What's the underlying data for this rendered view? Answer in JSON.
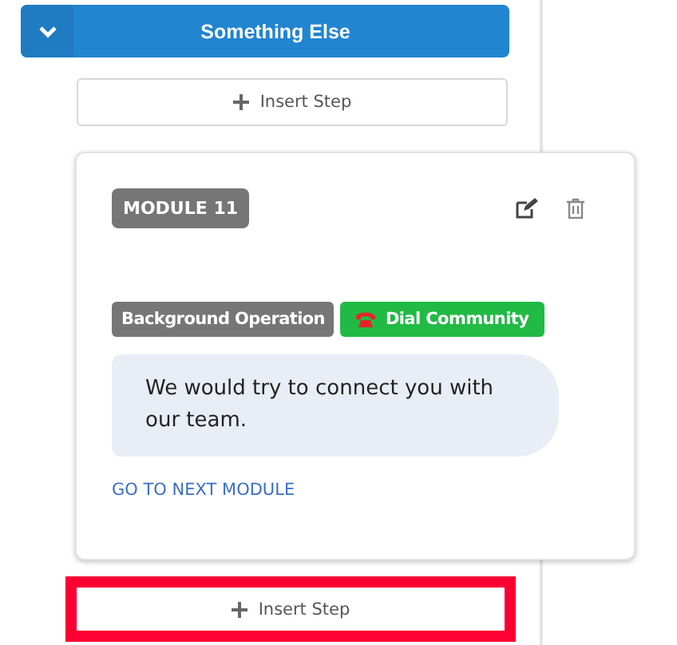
{
  "section_header": {
    "title": "Something Else",
    "expanded": true
  },
  "insert_step_top": {
    "label": "Insert Step",
    "highlighted": false
  },
  "module_card": {
    "badge": "MODULE 11",
    "tags": [
      {
        "label": "Background Operation",
        "kind": "operation"
      },
      {
        "label": "Dial Community",
        "kind": "dial"
      }
    ],
    "message": "We would try to connect you with our team.",
    "link": "GO TO NEXT MODULE"
  },
  "insert_step_bottom": {
    "label": "Insert Step",
    "highlighted": true
  }
}
